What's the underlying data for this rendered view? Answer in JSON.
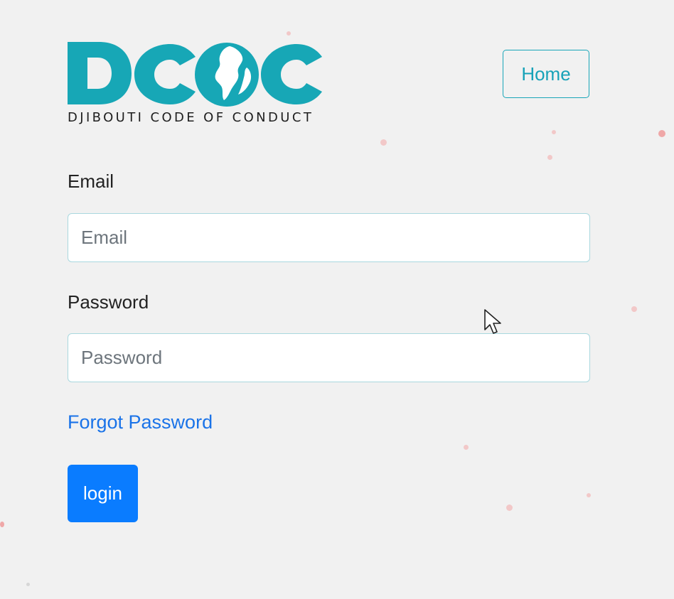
{
  "logo": {
    "letters": [
      "D",
      "C",
      "O",
      "C"
    ],
    "subtitle": "DJIBOUTI CODE OF CONDUCT",
    "brand_color": "#17a7b6"
  },
  "header": {
    "home_label": "Home"
  },
  "form": {
    "email_label": "Email",
    "email_placeholder": "Email",
    "email_value": "",
    "password_label": "Password",
    "password_placeholder": "Password",
    "password_value": "",
    "forgot_label": "Forgot Password",
    "login_label": "login"
  },
  "colors": {
    "background": "#f1f1f1",
    "accent": "#17a2b8",
    "link": "#1a73e8",
    "primary_button": "#0a7cff"
  }
}
